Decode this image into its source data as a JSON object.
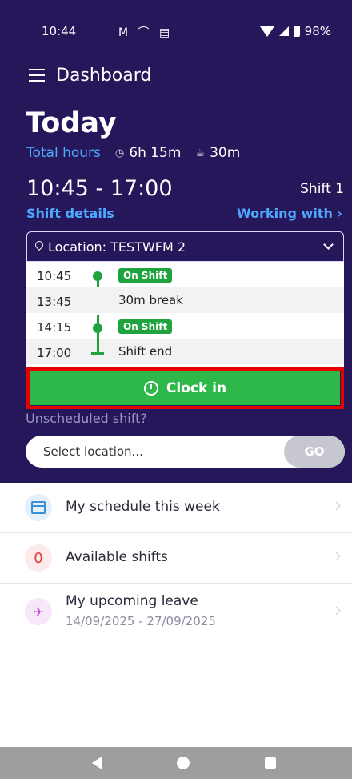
{
  "status_bar": {
    "time": "10:44",
    "icons_left": "M ⌒ ▤",
    "battery": "98%"
  },
  "appbar": {
    "title": "Dashboard"
  },
  "today": {
    "title": "Today",
    "total_hours_label": "Total hours",
    "hours_value": "6h 15m",
    "break_value": "30m"
  },
  "shift": {
    "time_range": "10:45 - 17:00",
    "shift_label": "Shift 1",
    "details_link": "Shift details",
    "working_with_link": "Working with ›"
  },
  "location": {
    "label": "Location: TESTWFM 2",
    "rows": [
      {
        "time": "10:45",
        "desc": "On Shift",
        "badge": true
      },
      {
        "time": "13:45",
        "desc": "30m break",
        "badge": false
      },
      {
        "time": "14:15",
        "desc": "On Shift",
        "badge": true
      },
      {
        "time": "17:00",
        "desc": "Shift end",
        "badge": false
      }
    ]
  },
  "clock_in": {
    "label": "Clock in"
  },
  "unscheduled": {
    "label": "Unscheduled shift?",
    "select_placeholder": "Select location...",
    "go_label": "GO"
  },
  "list": {
    "schedule": {
      "title": "My schedule this week"
    },
    "available": {
      "count": "0",
      "title": "Available shifts"
    },
    "leave": {
      "title": "My upcoming leave",
      "dates": "14/09/2025 - 27/09/2025"
    }
  },
  "colors": {
    "header_bg": "#26175a",
    "accent_blue": "#4fa8ff",
    "green": "#2eb84a",
    "highlight_red": "#e60000"
  },
  "icons": [
    "menu-icon",
    "clock-icon",
    "cup-icon",
    "pin-icon",
    "chevron-down-icon",
    "timer-icon",
    "calendar-icon",
    "plane-icon",
    "chevron-right-icon"
  ]
}
